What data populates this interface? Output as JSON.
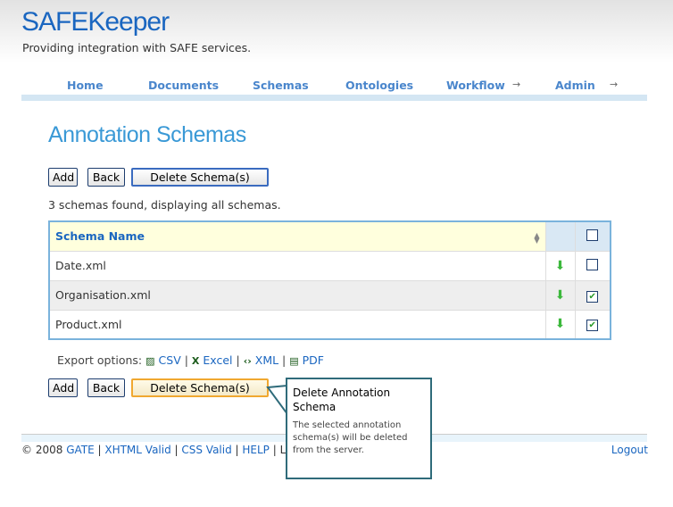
{
  "header": {
    "title": "SAFEKeeper",
    "tagline": "Providing integration with SAFE services."
  },
  "nav": [
    {
      "label": "Home"
    },
    {
      "label": "Documents"
    },
    {
      "label": "Schemas"
    },
    {
      "label": "Ontologies"
    },
    {
      "label": "Workflow",
      "arrow": "→"
    },
    {
      "label": "Admin",
      "arrow": "→"
    }
  ],
  "page_title": "Annotation Schemas",
  "buttons": {
    "add": "Add",
    "back": "Back",
    "delete": "Delete Schema(s)"
  },
  "status": "3 schemas found, displaying all schemas.",
  "table": {
    "header": "Schema Name",
    "rows": [
      {
        "name": "Date.xml",
        "checked": false
      },
      {
        "name": "Organisation.xml",
        "checked": true
      },
      {
        "name": "Product.xml",
        "checked": true
      }
    ]
  },
  "export": {
    "label": "Export options:",
    "csv": "CSV",
    "excel": "Excel",
    "xml": "XML",
    "pdf": "PDF"
  },
  "tooltip": {
    "title": "Delete Annotation Schema",
    "body": "The selected annotation schema(s) will be deleted from the server."
  },
  "footer": {
    "copyright": "© 2008",
    "gate": "GATE",
    "xhtml": "XHTML Valid",
    "css": "CSS Valid",
    "help": "HELP",
    "partial": "Lo",
    "logout": "Logout"
  }
}
